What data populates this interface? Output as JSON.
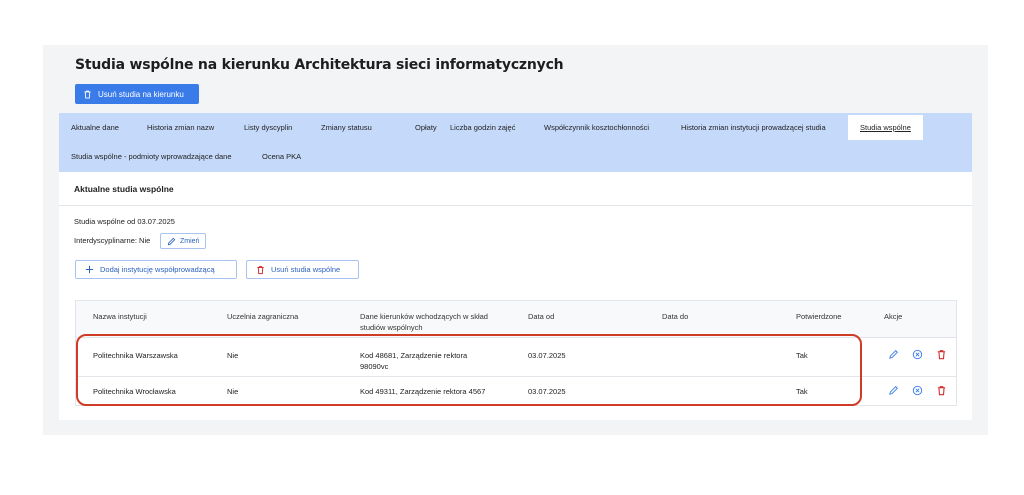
{
  "page": {
    "title": "Studia wspólne na kierunku Architektura sieci informatycznych",
    "remove_direction_button": "Usuń studia na kierunku"
  },
  "tabs": [
    {
      "label": "Aktualne dane"
    },
    {
      "label": "Historia zmian nazw"
    },
    {
      "label": "Listy dyscyplin"
    },
    {
      "label": "Zmiany statusu"
    },
    {
      "label": "Opłaty"
    },
    {
      "label": "Liczba godzin zajęć"
    },
    {
      "label": "Współczynnik kosztochłonności"
    },
    {
      "label": "Historia zmian instytucji prowadzącej studia"
    },
    {
      "label": "Studia wspólne",
      "active": true
    },
    {
      "label": "Studia wspólne - podmioty wprowadzające dane"
    },
    {
      "label": "Ocena PKA"
    }
  ],
  "panel": {
    "title": "Aktualne studia wspólne",
    "since": "Studia wspólne od 03.07.2025",
    "interdisciplinary": "Interdyscyplinarne: Nie",
    "change_button": "Zmień",
    "add_institution_button": "Dodaj instytucję współprowadzącą",
    "remove_joint_button": "Usuń studia wspólne"
  },
  "table": {
    "columns": [
      "Nazwa instytucji",
      "Uczelnia zagraniczna",
      "Dane kierunków wchodzących w skład studiów wspólnych",
      "Data od",
      "Data do",
      "Potwierdzone",
      "Akcje"
    ],
    "rows": [
      {
        "name": "Politechnika Warszawska",
        "foreign": "Nie",
        "details": "Kod 48681, Zarządzenie rektora 98090vc",
        "date_from": "03.07.2025",
        "date_to": "",
        "confirmed": "Tak"
      },
      {
        "name": "Politechnika Wrocławska",
        "foreign": "Nie",
        "details": "Kod 49311, Zarządzenie rektora 4567",
        "date_from": "03.07.2025",
        "date_to": "",
        "confirmed": "Tak"
      }
    ]
  },
  "colors": {
    "accent": "#3a7bea",
    "tabs_bg": "#c5d9fa",
    "highlight": "#cf3b25",
    "delete": "#d32f2f"
  }
}
